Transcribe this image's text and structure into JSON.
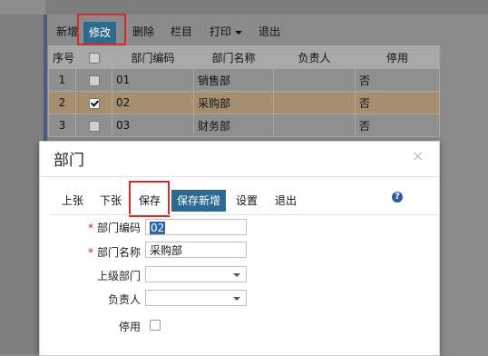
{
  "toolbar": {
    "new": "新增",
    "edit": "修改",
    "delete": "删除",
    "columns": "栏目",
    "print": "打印",
    "exit": "退出"
  },
  "grid": {
    "headers": [
      "序号",
      "",
      "部门编码",
      "部门名称",
      "负责人",
      "停用"
    ],
    "rows": [
      {
        "no": "1",
        "checked": false,
        "code": "01",
        "name": "销售部",
        "manager": "",
        "disabled": "否"
      },
      {
        "no": "2",
        "checked": true,
        "code": "02",
        "name": "采购部",
        "manager": "",
        "disabled": "否"
      },
      {
        "no": "3",
        "checked": false,
        "code": "03",
        "name": "财务部",
        "manager": "",
        "disabled": "否"
      }
    ]
  },
  "dialog": {
    "title": "部门",
    "close": "×",
    "toolbar": {
      "prev": "上张",
      "next": "下张",
      "save": "保存",
      "save_new": "保存新增",
      "settings": "设置",
      "exit": "退出",
      "help": "?"
    },
    "form": {
      "code_label": "部门编码",
      "code_value": "02",
      "name_label": "部门名称",
      "name_value": "采购部",
      "parent_label": "上级部门",
      "parent_value": "",
      "manager_label": "负责人",
      "manager_value": "",
      "disabled_label": "停用",
      "required_mark": "*"
    }
  },
  "colors": {
    "accent": "#2d6a8f",
    "highlight_box": "#d62b2b",
    "selected_row": "#a58f6f"
  }
}
